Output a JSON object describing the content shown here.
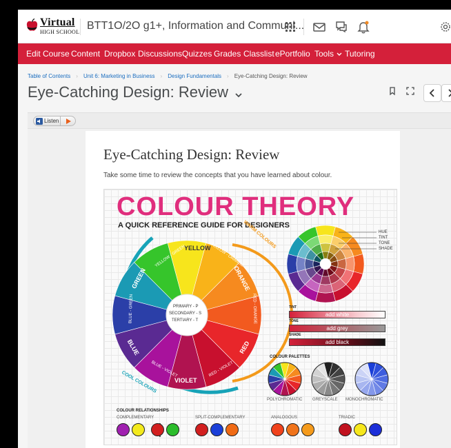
{
  "brand": {
    "logo_main": "Virtual",
    "logo_sub": "HIGH SCHOOL"
  },
  "course_title": "BTT1O/2O g1+, Information and Communi...",
  "nav": [
    "Edit Course",
    "Content",
    "Dropbox",
    "Discussions",
    "Quizzes",
    "Grades",
    "Classlist",
    "ePortfolio",
    "Tools",
    "Tutoring"
  ],
  "breadcrumbs": [
    "Table of Contents",
    "Unit 6: Marketing in Business",
    "Design Fundamentals",
    "Eye-Catching Design: Review"
  ],
  "page_title": "Eye-Catching Design: Review",
  "listen_label": "Listen",
  "card": {
    "title": "Eye-Catching Design: Review",
    "intro": "Take some time to review the concepts that you have learned about colour."
  },
  "infographic": {
    "title": "COLOUR THEORY",
    "subtitle": "A QUICK REFERENCE GUIDE FOR DESIGNERS",
    "warm": "WARM COLOURS",
    "cool": "COOL COLOURS",
    "wheel_labels": [
      "YELLOW",
      "YELLOW - GREEN",
      "YELLOW - ORANGE",
      "GREEN",
      "ORANGE",
      "BLUE - GREEN",
      "RED - ORANGE",
      "BLUE",
      "RED",
      "BLUE - VIOLET",
      "RED - VIOLET",
      "VIOLET"
    ],
    "center_lines": [
      "PRIMARY - P",
      "SECONDARY - S",
      "TERTIARY - T"
    ],
    "legend": [
      "HUE",
      "TINT",
      "TONE",
      "SHADE"
    ],
    "tint_label": "TINT",
    "tint_bar": "add white",
    "tone_label": "TONE",
    "tone_bar": "add grey",
    "shade_label": "SHADE",
    "shade_bar": "add black",
    "palettes_title": "COLOUR PALETTES",
    "palettes": [
      "POLYCHROMATIC",
      "GREYSCALE",
      "MONOCHROMATIC"
    ],
    "relationships_title": "COLOUR RELATIONSHIPS",
    "relationships": [
      "COMPLEMENTARY",
      "SPLIT-COMPLEMENTARY",
      "ANALOGOUS",
      "TRIADIC"
    ]
  },
  "colors": {
    "brand_red": "#d4203a",
    "title_pink": "#e02e7d",
    "warm_orange": "#f39a1b",
    "cool_teal": "#17a3b8"
  }
}
